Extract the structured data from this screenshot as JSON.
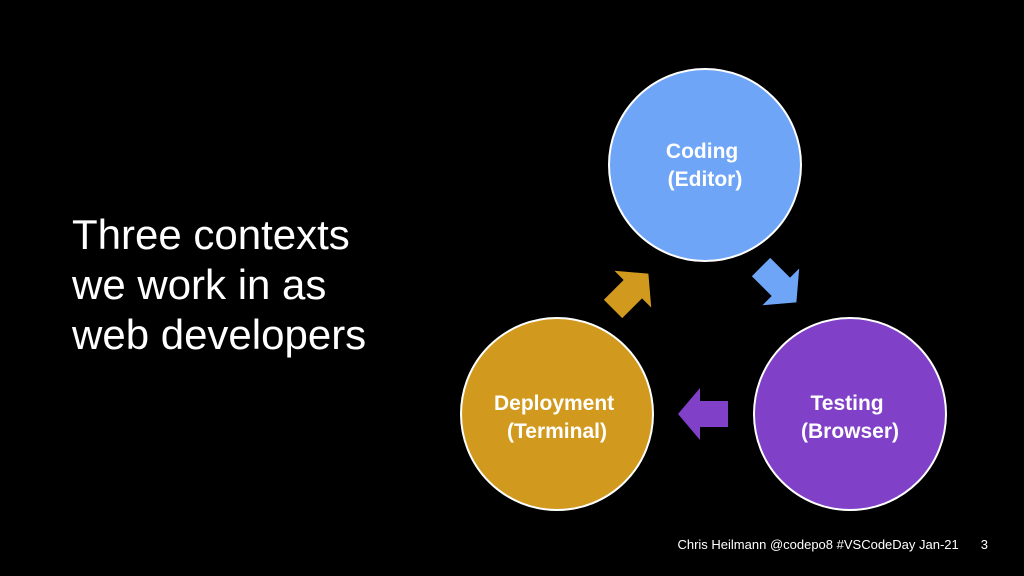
{
  "title_lines": [
    "Three contexts",
    "we work in as",
    "web developers"
  ],
  "nodes": [
    {
      "line1": "Coding",
      "line2": "(Editor)",
      "color": "#6ea5f7"
    },
    {
      "line1": "Testing",
      "line2": "(Browser)",
      "color": "#8040c8"
    },
    {
      "line1": "Deployment",
      "line2": "(Terminal)",
      "color": "#d19a1e"
    }
  ],
  "arrow_colors": [
    "#6ea5f7",
    "#8040c8",
    "#d19a1e"
  ],
  "footer": {
    "credit": "Chris Heilmann @codepo8 #VSCodeDay Jan-21",
    "page_number": "3"
  }
}
